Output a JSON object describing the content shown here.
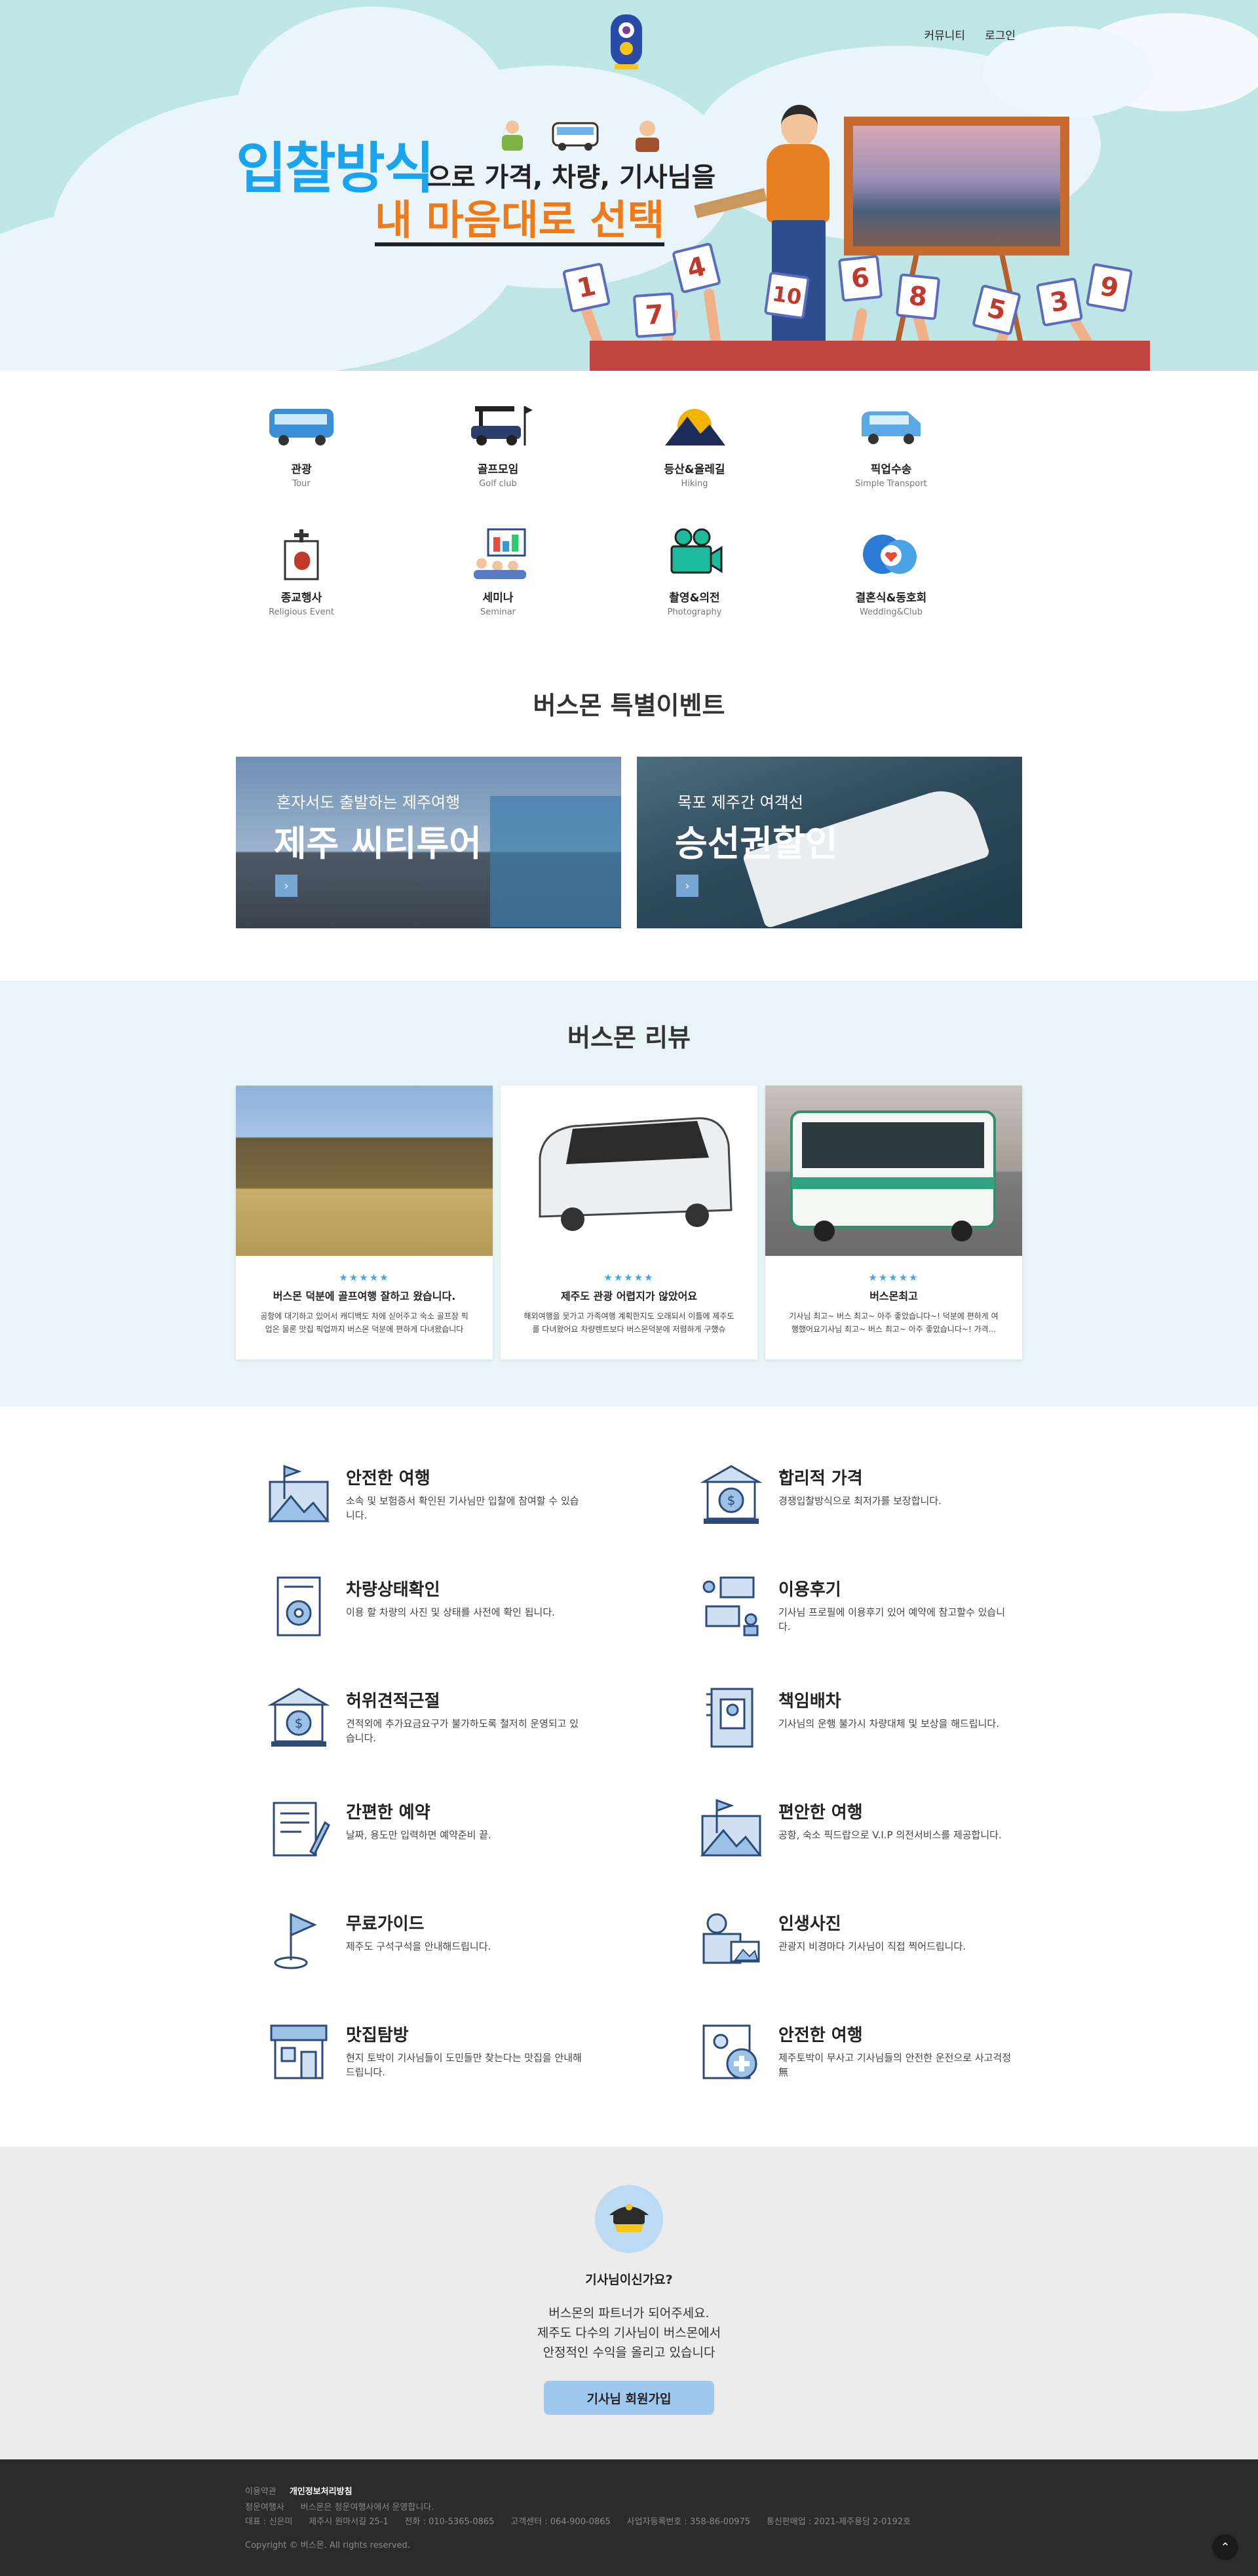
{
  "nav": {
    "community": "커뮤니티",
    "login": "로그인"
  },
  "hero": {
    "title_blue": "입찰방식",
    "title_rest": "으로 가격, 차량, 기사님을",
    "title_orange": "내 마음대로 선택",
    "cards": [
      "1",
      "4",
      "7",
      "10",
      "6",
      "8",
      "5",
      "3",
      "9"
    ]
  },
  "categories": [
    {
      "name": "관광",
      "sub": "Tour",
      "icon": "tour-bus-icon"
    },
    {
      "name": "골프모임",
      "sub": "Golf club",
      "icon": "golf-cart-icon"
    },
    {
      "name": "등산&올레길",
      "sub": "Hiking",
      "icon": "hiking-icon"
    },
    {
      "name": "픽업수송",
      "sub": "Simple Transport",
      "icon": "van-icon"
    },
    {
      "name": "종교행사",
      "sub": "Religious Event",
      "icon": "church-icon"
    },
    {
      "name": "세미나",
      "sub": "Seminar",
      "icon": "seminar-icon"
    },
    {
      "name": "촬영&의전",
      "sub": "Photography",
      "icon": "camera-icon"
    },
    {
      "name": "결혼식&동호회",
      "sub": "Wedding&Club",
      "icon": "heart-people-icon"
    }
  ],
  "events": {
    "title": "버스몬 특별이벤트",
    "items": [
      {
        "sub": "혼자서도 출발하는 제주여행",
        "title": "제주 씨티투어"
      },
      {
        "sub": "목포 제주간 여객선",
        "title": "승선권할인"
      }
    ]
  },
  "reviews": {
    "title": "버스몬 리뷰",
    "stars": "★★★★★",
    "items": [
      {
        "title": "버스몬 덕분에 골프여행 잘하고 왔습니다.",
        "text": "공항에 대기하고 있어서 캐디백도 차에 싣어주고 숙소 골프장 픽업은 물론 맛집 픽업까지 버스몬 덕분에 편하게 다녀왔습니다"
      },
      {
        "title": "제주도 관광 어렵지가 않았어요",
        "text": "해외여행을 못가고 가족여행 계획한지도 오래되서 이틀에 제주도를 다녀왔어요 차량렌트보다 버스몬덕분에 저렴하게 구했슈"
      },
      {
        "title": "버스몬최고",
        "text": "기사님 최고~ 버스 최고~ 아주 좋았습니다~! 덕분에 편하게 여행했어요기사님 최고~ 버스 최고~ 아주 좋았습니다~! 가격..."
      }
    ]
  },
  "features": [
    {
      "title": "안전한 여행",
      "desc": "소속 및 보험증서 확인된 기사님만 입찰에 참여할 수 있습니다.",
      "icon": "flag-map-icon"
    },
    {
      "title": "합리적 가격",
      "desc": "경쟁입찰방식으로 최저가를 보장합니다.",
      "icon": "bank-dollar-icon"
    },
    {
      "title": "차량상태확인",
      "desc": "이용 할 차량의 사진 및 상태를 사전에 확인 됩니다.",
      "icon": "document-gear-icon"
    },
    {
      "title": "이용후기",
      "desc": "기사님 프로필에 이용후기 있어 예약에 참고할수 있습니다.",
      "icon": "chat-people-icon"
    },
    {
      "title": "허위견적근절",
      "desc": "견적외에 추가요금요구가 불가하도록 철저히 운영되고 있습니다.",
      "icon": "bank-dollar-icon"
    },
    {
      "title": "책임배차",
      "desc": "기사님의 운행 불가시 차량대체 및 보상을 해드립니다.",
      "icon": "profile-book-icon"
    },
    {
      "title": "간편한 예약",
      "desc": "날짜, 용도만 입력하면 예약준비 끝.",
      "icon": "document-pen-icon"
    },
    {
      "title": "편안한 여행",
      "desc": "공항, 숙소 픽드랍으로 V.I.P 의전서비스를 제공합니다.",
      "icon": "flag-map-icon"
    },
    {
      "title": "무료가이드",
      "desc": "제주도 구석구석을 안내해드립니다.",
      "icon": "flag-pin-icon"
    },
    {
      "title": "인생사진",
      "desc": "관광지 비경마다 기사님이 직접 찍어드립니다.",
      "icon": "video-camera-icon"
    },
    {
      "title": "맛집탐방",
      "desc": "현지 토박이 기사님들이 도민들만 찾는다는 맛집을 안내해드립니다.",
      "icon": "store-icon"
    },
    {
      "title": "안전한 여행",
      "desc": "제주토박이 무사고 기사님들의 안전한 운전으로 사고걱정 無",
      "icon": "medical-profile-icon"
    }
  ],
  "driver": {
    "question": "기사님이신가요?",
    "line1": "버스몬의 파트너가 되어주세요.",
    "line2": "제주도 다수의 기사님이 버스몬에서",
    "line3": "안정적인 수익을 올리고 있습니다",
    "button": "기사님 회원가입"
  },
  "footer": {
    "terms": "이용약관",
    "privacy": "개인정보처리방침",
    "line1_label": "청운여행사",
    "line1_text": "버스몬은 청운여행사에서 운영합니다.",
    "line2": "대표 : 신은미      제주시 원마서길 25-1      전화 : 010-5365-0865      고객센터 : 064-900-0865      사업자등록번호 : 358-86-00975      통신판매업 : 2021-제주용담 2-0192호",
    "copyright": "Copyright © 버스몬. All rights reserved.",
    "top": "⌃"
  },
  "colors": {
    "accent_blue": "#1aa3ee",
    "accent_orange": "#f07a18",
    "hero_bg": "#bfe6e6",
    "review_bg": "#e8f4f6",
    "button_blue": "#9fc8ef"
  }
}
